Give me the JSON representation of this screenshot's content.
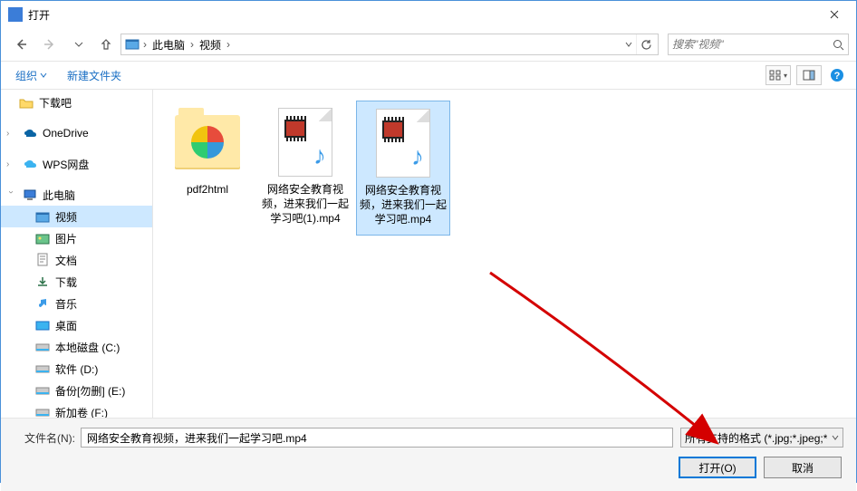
{
  "title": "打开",
  "breadcrumb": {
    "pc": "此电脑",
    "video": "视频"
  },
  "search": {
    "placeholder": "搜索\"视频\""
  },
  "toolbar": {
    "organize": "组织",
    "new_folder": "新建文件夹"
  },
  "sidebar": {
    "download_ba": "下载吧",
    "onedrive": "OneDrive",
    "wps": "WPS网盘",
    "this_pc": "此电脑",
    "video": "视频",
    "pictures": "图片",
    "documents": "文档",
    "downloads": "下载",
    "music": "音乐",
    "desktop": "桌面",
    "local_c": "本地磁盘 (C:)",
    "soft_d": "软件 (D:)",
    "backup_e": "备份[勿删] (E:)",
    "new_vol": "新加卷 (F:)"
  },
  "files": {
    "f1": "pdf2html",
    "f2": "网络安全教育视频，进来我们一起学习吧(1).mp4",
    "f3": "网络安全教育视频，进来我们一起学习吧.mp4"
  },
  "bottom": {
    "filename_label": "文件名(N):",
    "filename_value": "网络安全教育视频，进来我们一起学习吧.mp4",
    "filetype_value": "所有支持的格式 (*.jpg;*.jpeg;*",
    "open": "打开(O)",
    "cancel": "取消"
  }
}
